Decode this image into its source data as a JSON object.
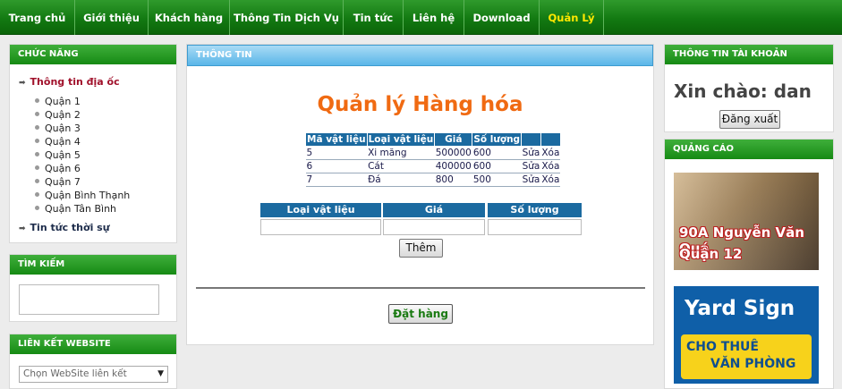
{
  "nav": {
    "items": [
      "Trang chủ",
      "Giới thiệu",
      "Khách hàng",
      "Thông Tin Dịch Vụ",
      "Tin tức",
      "Liên hệ",
      "Download",
      "Quản Lý"
    ]
  },
  "left": {
    "chuc_nang": {
      "title": "CHỨC NĂNG",
      "main1": "Thông tin địa ốc",
      "districts": [
        "Quận 1",
        "Quận 2",
        "Quận 3",
        "Quận 4",
        "Quận 5",
        "Quận 6",
        "Quận 7",
        "Quận Bình Thạnh",
        "Quận Tân Bình"
      ],
      "main2": "Tin tức thời sự"
    },
    "search": {
      "title": "TÌM KIẾM"
    },
    "links": {
      "title": "LIÊN KẾT WEBSITE",
      "selected": "Chọn WebSite liên kết"
    }
  },
  "center": {
    "header": "THÔNG TIN",
    "title": "Quản lý Hàng hóa",
    "table": {
      "columns": [
        "Mã vật liệu",
        "Loại vật liệu",
        "Giá",
        "Số lượng",
        "",
        ""
      ],
      "rows": [
        [
          "5",
          "Xi măng",
          "500000",
          "600",
          "Sửa",
          "Xóa"
        ],
        [
          "6",
          "Cát",
          "400000",
          "600",
          "Sửa",
          "Xóa"
        ],
        [
          "7",
          "Đá",
          "800",
          "500",
          "Sửa",
          "Xóa"
        ]
      ]
    },
    "form": {
      "labels": [
        "Loại vật liệu",
        "Giá",
        "Số lượng"
      ],
      "add_button": "Thêm"
    },
    "order_button": "Đặt hàng"
  },
  "right": {
    "account": {
      "title": "THÔNG TIN TÀI KHOẢN",
      "greeting": "Xin chào: dan",
      "logout": "Đăng xuất"
    },
    "ads": {
      "title": "QUẢNG CÁO",
      "ad1_line1": "90A Nguyễn Văn Quá,",
      "ad1_line2": "Quận 12",
      "ad2_title": "Yard Sign",
      "ad2_line1": "CHO THUÊ",
      "ad2_line2": "VĂN PHÒNG"
    }
  }
}
